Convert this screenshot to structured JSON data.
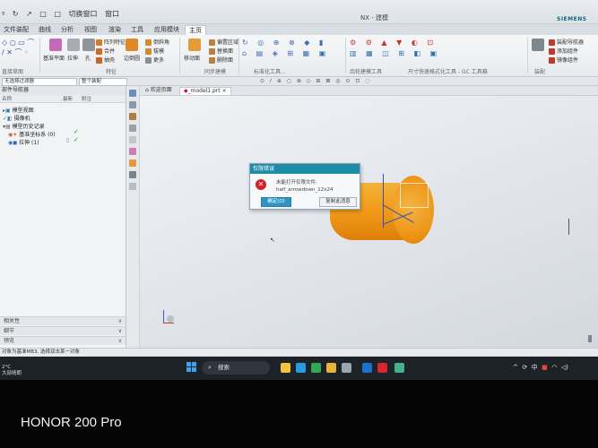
{
  "titlebar": {
    "qat": [
      "ᵍ",
      "↻",
      "↗",
      "□",
      "□",
      "切换窗口",
      "窗口"
    ],
    "title": "NX - 建模",
    "brand": "SIEMENS"
  },
  "ribbon_tabs": [
    "文件",
    "装配",
    "曲线",
    "分析",
    "视图",
    "渲染",
    "工具",
    "应用模块",
    "主页"
  ],
  "ribbon": {
    "base_plane": "基准平面",
    "extrude": "拉伸",
    "hole": "孔",
    "array_feature": "阵列特征",
    "merge": "合并",
    "shell": "抽壳",
    "edge_blend": "边倒圆",
    "chamfer": "倒斜角",
    "draft": "拔模",
    "more": "更多",
    "move_face": "移动面",
    "replace_face": "替换面",
    "delete_face": "删除面",
    "offset_region": "偏置区域",
    "group_feature": "特征",
    "group_sync": "同步建模",
    "group_std": "标准化工具...",
    "group_gear": "齿轮建模工具",
    "group_dim": "尺寸快速格式化工具 - GC 工具箱",
    "group_assembly": "装配",
    "group_curve": "直接草图",
    "assembly_navigator": "装配导航器",
    "add_component": "添加组件",
    "mirror_component": "镜像组件"
  },
  "toolbar2": {
    "filter_label": "无选择过滤器",
    "scope_label": "整个装配"
  },
  "navigator": {
    "title": "部件导航器",
    "col_name": "名称",
    "col_latest": "最新",
    "col_note": "附注",
    "items": [
      {
        "label": "模型视图"
      },
      {
        "label": "摄像机"
      },
      {
        "label": "模型历史记录"
      },
      {
        "label": "基准坐标系 (0)"
      },
      {
        "label": "拉伸 (1)"
      }
    ],
    "panels": [
      "相关性",
      "细节",
      "预览"
    ]
  },
  "graphics": {
    "tabs": [
      "欢迎页面",
      "_model1.prt"
    ]
  },
  "dialog": {
    "title": "仅限错误",
    "message_line1": "未能打开仅限文件:",
    "message_line2": "half_arrowdown_12x24",
    "ok_label": "确定(O)",
    "copy_label": "复制此消息"
  },
  "status_bar": {
    "text": "对象为基准MB3, 选择双击某一对象"
  },
  "taskbar": {
    "weather_temp": "2°C",
    "weather_desc": "大部晴朗",
    "search_label": "搜索",
    "ime": "中",
    "apps": [
      {
        "name": "file-explorer",
        "color": "#f3c33b"
      },
      {
        "name": "edge",
        "color": "#2a9ae0"
      },
      {
        "name": "chrome",
        "color": "#34a853"
      },
      {
        "name": "folder",
        "color": "#e8b53a"
      },
      {
        "name": "settings",
        "color": "#9aa6b2"
      },
      {
        "name": "outlook",
        "color": "#1a73c9"
      },
      {
        "name": "wps",
        "color": "#d9262c"
      },
      {
        "name": "nx",
        "color": "#45b08a"
      }
    ]
  },
  "photo_caption": "HONOR 200 Pro"
}
